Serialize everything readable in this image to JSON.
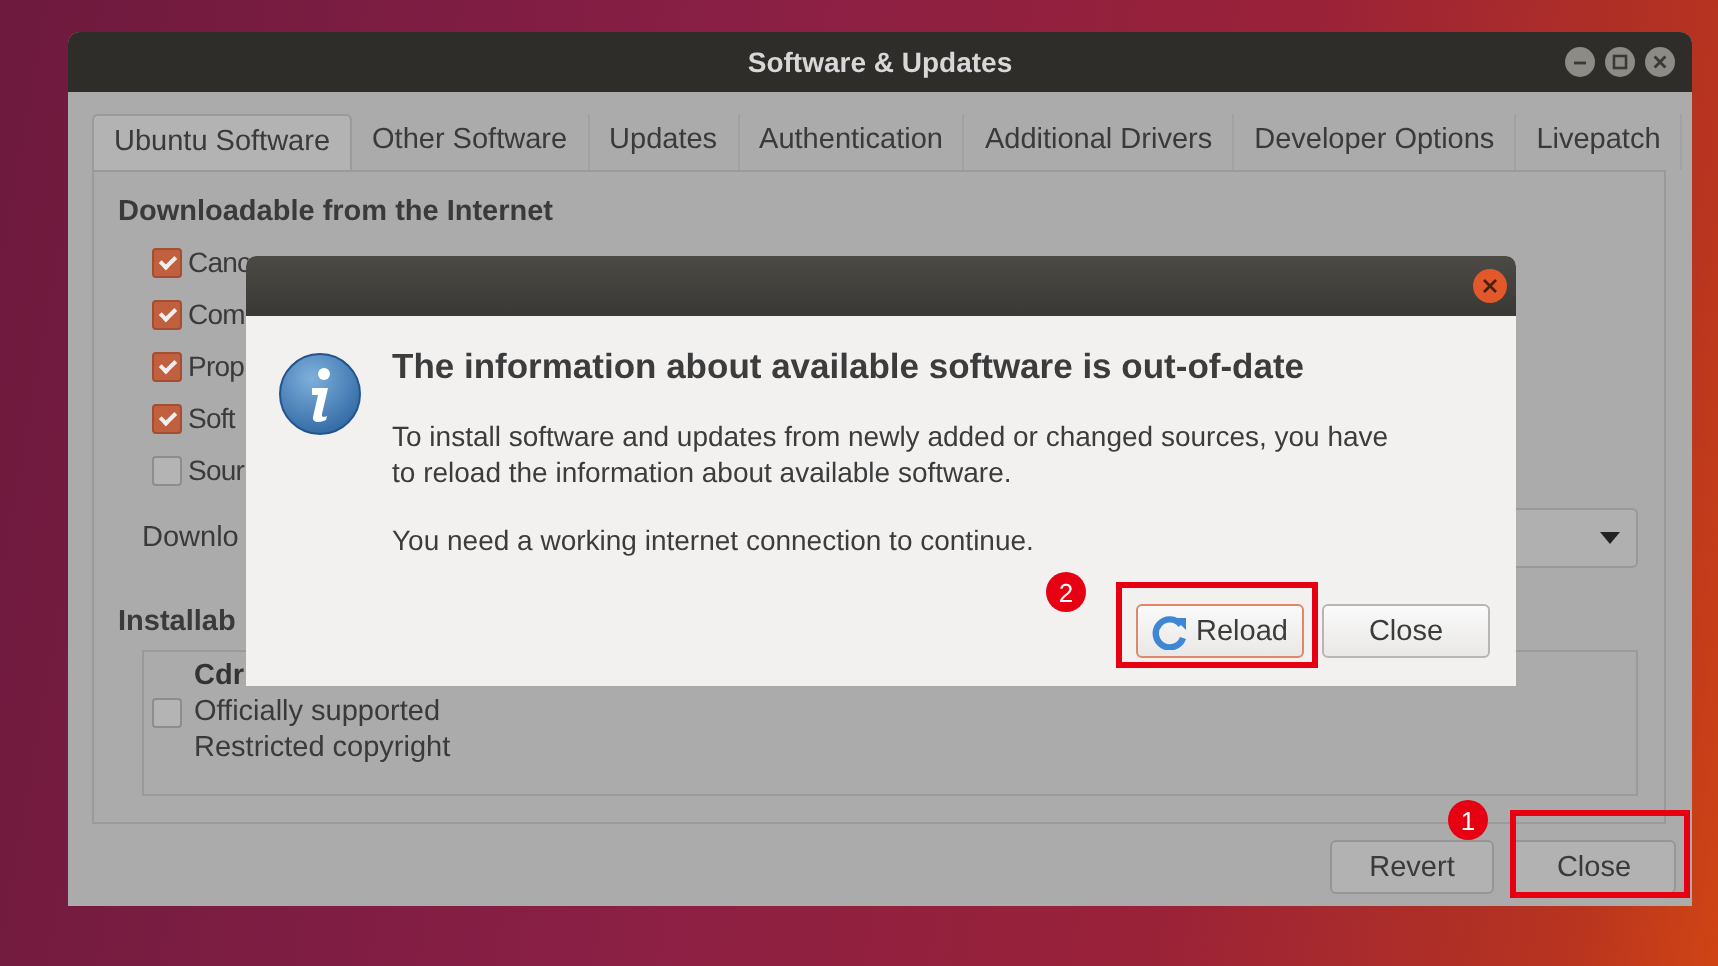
{
  "window": {
    "title": "Software & Updates"
  },
  "tabs": [
    {
      "label": "Ubuntu Software",
      "selected": true
    },
    {
      "label": "Other Software",
      "selected": false
    },
    {
      "label": "Updates",
      "selected": false
    },
    {
      "label": "Authentication",
      "selected": false
    },
    {
      "label": "Additional Drivers",
      "selected": false
    },
    {
      "label": "Developer Options",
      "selected": false
    },
    {
      "label": "Livepatch",
      "selected": false
    }
  ],
  "downloadable": {
    "heading": "Downloadable from the Internet",
    "options": [
      {
        "label": "Canc",
        "checked": true
      },
      {
        "label": "Com",
        "checked": true
      },
      {
        "label": "Prop",
        "checked": true
      },
      {
        "label": "Soft",
        "checked": true
      },
      {
        "label": "Sour",
        "checked": false
      }
    ],
    "download_from_label": "Downlo"
  },
  "installable": {
    "heading": "Installab",
    "sources": [
      {
        "title": "Cdr",
        "lines": [
          "Officially supported",
          "Restricted copyright"
        ],
        "checked": false
      }
    ]
  },
  "buttons": [
    {
      "label": "Revert"
    },
    {
      "label": "Close",
      "annotation": "1"
    }
  ],
  "dialog": {
    "title": "The information about available software is out-of-date",
    "body": [
      "To install software and updates from newly added or changed sources, you have to reload the information about available software.",
      "You need a working internet connection to continue."
    ],
    "buttons": [
      {
        "label": "Reload",
        "kind": "reload",
        "focused": true,
        "annotation": "2"
      },
      {
        "label": "Close",
        "kind": "plain",
        "focused": false
      }
    ]
  }
}
